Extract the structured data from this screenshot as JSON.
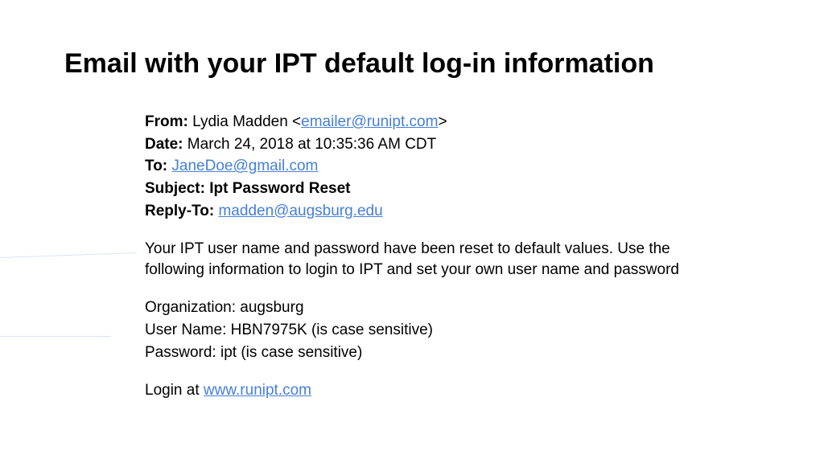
{
  "title": "Email with your IPT default log-in information",
  "email": {
    "from_label": "From:",
    "from_name": " Lydia Madden <",
    "from_email": "emailer@runipt.com",
    "from_close": ">",
    "date_label": "Date:",
    "date_value": " March 24, 2018 at 10:35:36 AM CDT",
    "to_label": "To:",
    "to_email": "JaneDoe@gmail.com",
    "subject_label": "Subject: Ipt Password Reset",
    "replyto_label": "Reply-To:",
    "replyto_email": "madden@augsburg.edu"
  },
  "body": {
    "intro": "Your IPT user name and password have been reset to default values. Use the following information to login to IPT and set your own user name and password",
    "org": "Organization: augsburg",
    "user": "User Name: HBN7975K (is case sensitive)",
    "pwd": "Password:  ipt (is case sensitive)",
    "login_prefix": "Login at ",
    "login_url": "www.runipt.com"
  }
}
